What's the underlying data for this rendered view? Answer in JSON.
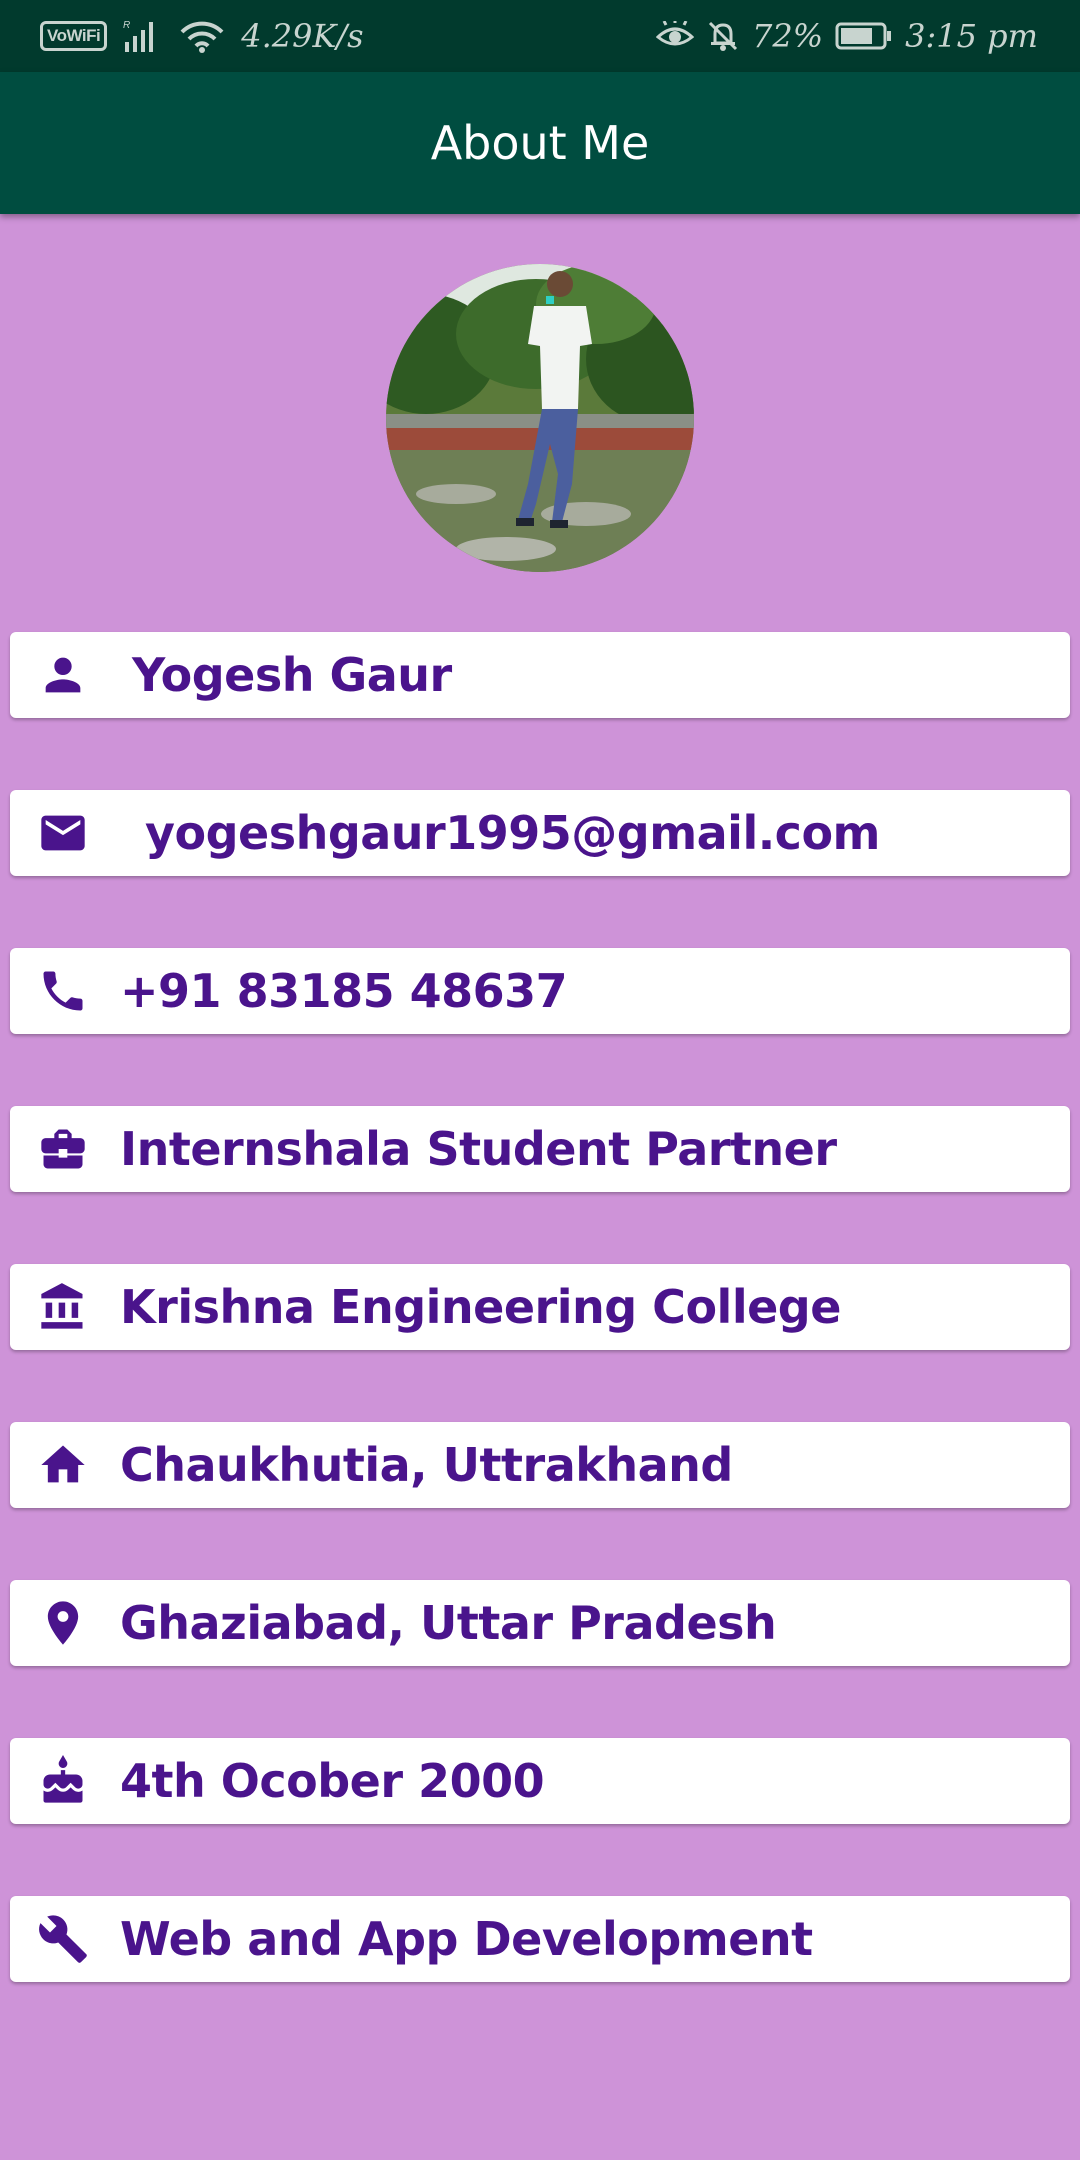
{
  "status_bar": {
    "wifi_badge": "VoWiFi",
    "speed": "4.29K/s",
    "battery": "72%",
    "time": "3:15 pm"
  },
  "app_bar": {
    "title": "About Me"
  },
  "profile": {
    "name": "Yogesh Gaur",
    "email": "yogeshgaur1995@gmail.com",
    "phone": "+91 83185 48637",
    "role": "Internshala Student Partner",
    "college": "Krishna Engineering College",
    "hometown": "Chaukhutia, Uttrakhand",
    "location": "Ghaziabad, Uttar Pradesh",
    "birthday": "4th Ocober 2000",
    "skills": "Web and App Development"
  },
  "icons": {
    "name": "person-icon",
    "email": "mail-icon",
    "phone": "phone-icon",
    "role": "briefcase-icon",
    "college": "institution-icon",
    "hometown": "home-icon",
    "location": "location-pin-icon",
    "birthday": "cake-icon",
    "skills": "wrench-icon"
  },
  "colors": {
    "status_bar": "#013a2d",
    "app_bar": "#004d40",
    "background": "#ce93d8",
    "card": "#ffffff",
    "accent_text": "#4a148c"
  }
}
